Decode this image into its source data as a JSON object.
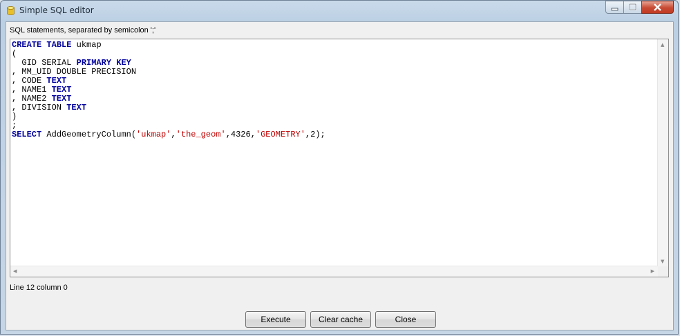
{
  "window": {
    "title": "Simple SQL editor"
  },
  "editor": {
    "label": "SQL statements, separated by semicolon ';'",
    "lines": [
      [
        {
          "t": "CREATE",
          "k": true
        },
        {
          "t": " "
        },
        {
          "t": "TABLE",
          "k": true
        },
        {
          "t": " ukmap"
        }
      ],
      [
        {
          "t": "("
        }
      ],
      [
        {
          "t": "  GID SERIAL "
        },
        {
          "t": "PRIMARY",
          "k": true
        },
        {
          "t": " "
        },
        {
          "t": "KEY",
          "k": true
        }
      ],
      [
        {
          "t": ", MM_UID DOUBLE PRECISION"
        }
      ],
      [
        {
          "t": ", CODE "
        },
        {
          "t": "TEXT",
          "k": true
        }
      ],
      [
        {
          "t": ", NAME1 "
        },
        {
          "t": "TEXT",
          "k": true
        }
      ],
      [
        {
          "t": ", NAME2 "
        },
        {
          "t": "TEXT",
          "k": true
        }
      ],
      [
        {
          "t": ", DIVISION "
        },
        {
          "t": "TEXT",
          "k": true
        }
      ],
      [
        {
          "t": ")"
        }
      ],
      [
        {
          "t": ";"
        }
      ],
      [
        {
          "t": "SELECT",
          "k": true
        },
        {
          "t": " AddGeometryColumn("
        },
        {
          "t": "'ukmap'",
          "s": true
        },
        {
          "t": ","
        },
        {
          "t": "'the_geom'",
          "s": true
        },
        {
          "t": ",4326,"
        },
        {
          "t": "'GEOMETRY'",
          "s": true
        },
        {
          "t": ",2);"
        }
      ]
    ]
  },
  "status": {
    "cursor": "Line 12 column 0"
  },
  "buttons": {
    "execute": "Execute",
    "clear_cache": "Clear cache",
    "close": "Close"
  },
  "colors": {
    "keyword": "#00009c",
    "string": "#c00000"
  }
}
